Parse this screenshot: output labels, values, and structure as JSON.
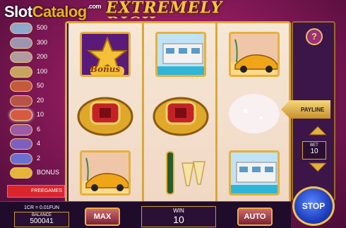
{
  "watermark": {
    "brand_a": "Slot",
    "brand_b": "Catalog",
    "tld": ".com"
  },
  "title": "EXTREMELY RICH",
  "paytable": {
    "rows": [
      {
        "value": "500",
        "color": "#8fa7c8"
      },
      {
        "value": "300",
        "color": "#9d95b0"
      },
      {
        "value": "200",
        "color": "#b19aa0"
      },
      {
        "value": "100",
        "color": "#c7a35f"
      },
      {
        "value": "50",
        "color": "#c45a3a"
      },
      {
        "value": "20",
        "color": "#b8524a"
      },
      {
        "value": "10",
        "color": "#d65a3f"
      },
      {
        "value": "6",
        "color": "#9b5ba8"
      },
      {
        "value": "4",
        "color": "#7e5ec0"
      },
      {
        "value": "2",
        "color": "#6a6fd0"
      },
      {
        "value": "BONUS",
        "color": "#e5b43a"
      }
    ],
    "freegames": "FREEGAMES"
  },
  "reels": [
    [
      "bonus-star",
      "ruby-ring",
      "yellow-car"
    ],
    [
      "villa",
      "ruby-ring",
      "champagne"
    ],
    [
      "yellow-car",
      "sparkle",
      "villa"
    ]
  ],
  "bonus_label": "Bonus",
  "help_label": "?",
  "payline_label": "PAYLINE",
  "bet": {
    "label": "BET",
    "value": "10"
  },
  "stop_label": "STOP",
  "bottom": {
    "denomination": "1CR = 0.01FUN",
    "balance_label": "BALANCE",
    "balance_value": "500041",
    "max_label": "MAX",
    "win_label": "WIN",
    "win_value": "10",
    "auto_label": "AUTO"
  }
}
